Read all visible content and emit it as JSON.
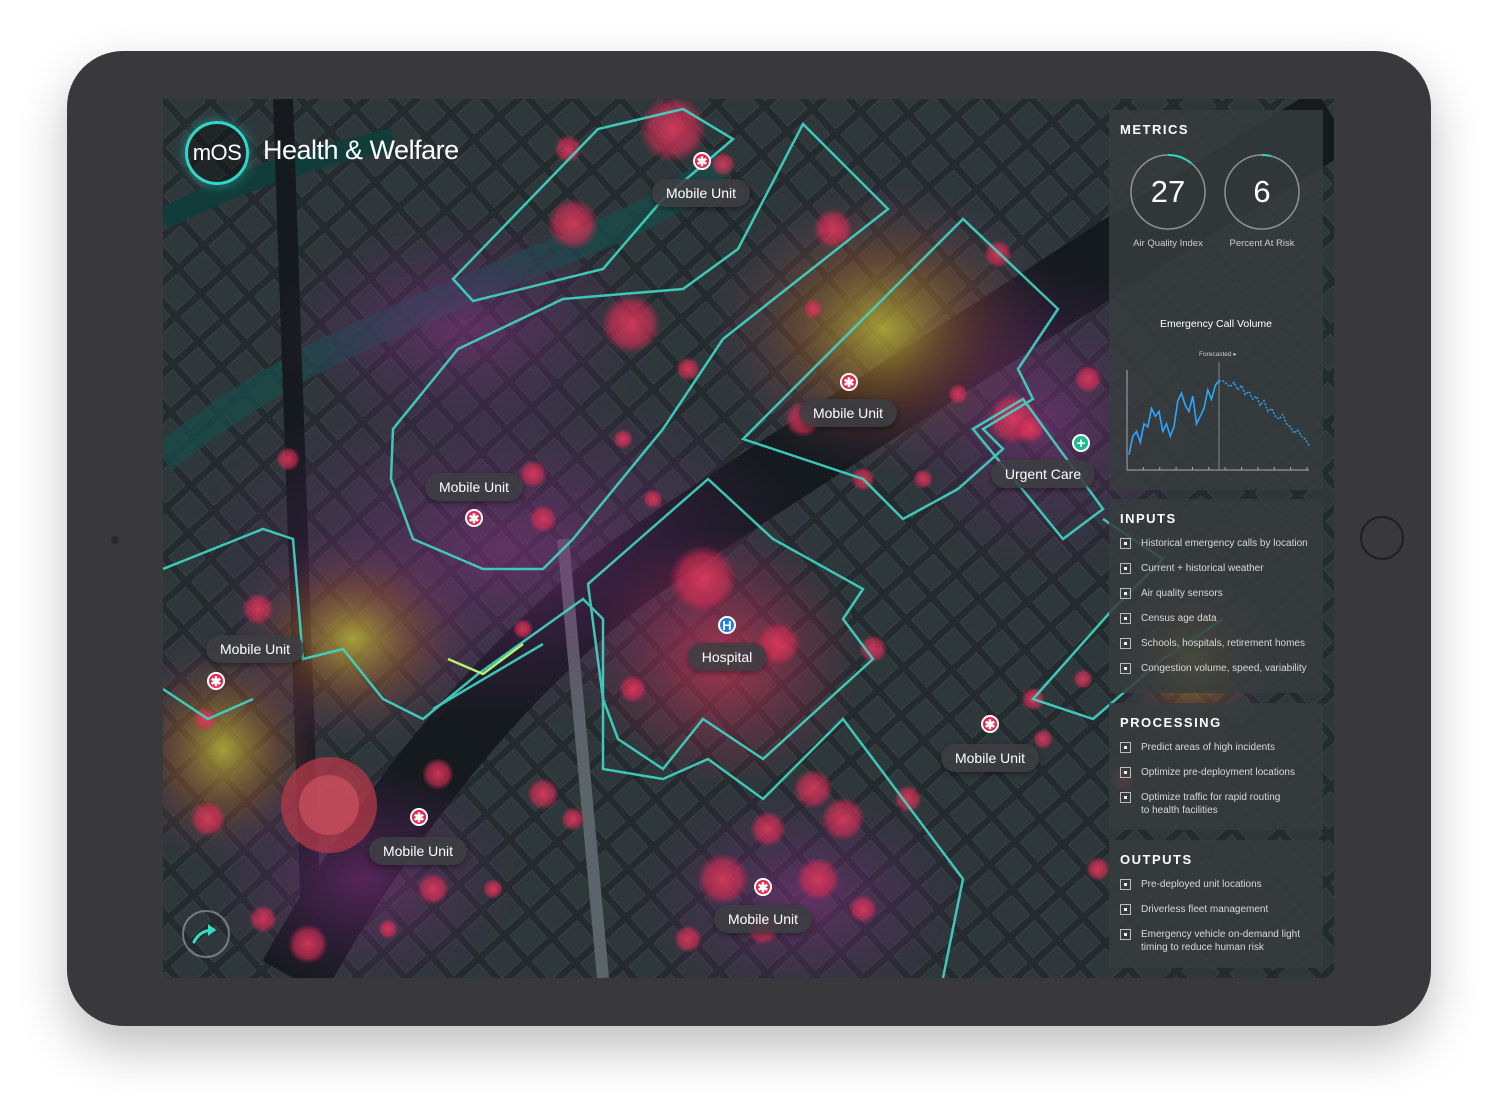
{
  "app": {
    "logo": "mOS",
    "title": "Health & Welfare"
  },
  "map": {
    "markers": [
      {
        "label": "Mobile Unit",
        "icon": "medical-asterisk-icon",
        "type": "mobile"
      },
      {
        "label": "Mobile Unit",
        "icon": "medical-asterisk-icon",
        "type": "mobile"
      },
      {
        "label": "Mobile Unit",
        "icon": "medical-asterisk-icon",
        "type": "mobile"
      },
      {
        "label": "Urgent Care",
        "icon": "plus-icon",
        "type": "urgent"
      },
      {
        "label": "Mobile Unit",
        "icon": "medical-asterisk-icon",
        "type": "mobile"
      },
      {
        "label": "Hospital",
        "icon": "hospital-h-icon",
        "type": "hospital"
      },
      {
        "label": "Mobile Unit",
        "icon": "medical-asterisk-icon",
        "type": "mobile"
      },
      {
        "label": "Mobile Unit",
        "icon": "medical-asterisk-icon",
        "type": "mobile"
      },
      {
        "label": "Mobile Unit",
        "icon": "medical-asterisk-icon",
        "type": "mobile"
      }
    ],
    "nav_icon": "arrow-turn-icon"
  },
  "metrics": {
    "heading": "METRICS",
    "air_quality": {
      "value": "27",
      "label": "Air Quality Index"
    },
    "percent_at_risk": {
      "value": "6",
      "label": "Percent At Risk"
    },
    "chart_title": "Emergency Call Volume",
    "forecast_label": "Forecasted ▸"
  },
  "chart_data": {
    "type": "line",
    "title": "Emergency Call Volume",
    "annotations": [
      "Forecasted ▸"
    ],
    "series": [
      {
        "values": [
          10,
          22,
          25,
          18,
          30,
          28,
          40,
          35,
          38,
          25,
          30,
          22,
          28,
          45,
          50,
          42,
          38,
          48,
          30,
          35,
          40,
          52,
          46,
          55,
          58
        ]
      },
      {
        "values": [
          58,
          56,
          54,
          57,
          52,
          55,
          49,
          51,
          46,
          48,
          42,
          45,
          38,
          40,
          35,
          33,
          36,
          30,
          28,
          24,
          26,
          22,
          20,
          16
        ]
      }
    ]
  },
  "inputs": {
    "heading": "INPUTS",
    "items": [
      "Historical emergency calls by location",
      "Current + historical weather",
      "Air quality sensors",
      "Census age data",
      "Schools, hospitals, retirement homes",
      "Congestion volume, speed, variability"
    ]
  },
  "processing": {
    "heading": "PROCESSING",
    "items": [
      "Predict areas of high incidents",
      "Optimize pre-deployment locations",
      "Optimize traffic for rapid routing to health facilities"
    ]
  },
  "outputs": {
    "heading": "OUTPUTS",
    "items": [
      "Pre-deployed unit locations",
      "Driverless fleet management",
      "Emergency vehicle on-demand light timing to reduce human risk"
    ]
  }
}
